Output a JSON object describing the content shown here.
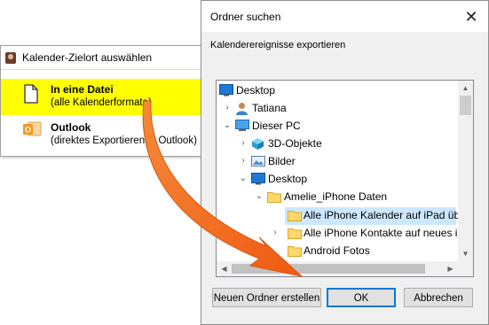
{
  "left_panel": {
    "title": "Kalender-Zielort auswählen",
    "options": [
      {
        "label": "In eine Datei",
        "sublabel": "(alle Kalenderformate)",
        "selected": true,
        "icon": "file-icon"
      },
      {
        "label": "Outlook",
        "sublabel": "(direktes Exportieren in Outlook)",
        "selected": false,
        "icon": "outlook-icon"
      }
    ]
  },
  "dialog": {
    "title": "Ordner suchen",
    "close_glyph": "✕",
    "description": "Kalenderereignisse exportieren",
    "tree": [
      {
        "label": "Desktop",
        "icon": "desktop-icon"
      },
      {
        "label": "Tatiana",
        "icon": "user-icon"
      },
      {
        "label": "Dieser PC",
        "icon": "pc-icon"
      },
      {
        "label": "3D-Objekte",
        "icon": "cube-icon"
      },
      {
        "label": "Bilder",
        "icon": "pictures-icon"
      },
      {
        "label": "Desktop",
        "icon": "desktop-icon"
      },
      {
        "label": "Amelie_iPhone Daten",
        "icon": "folder-icon"
      },
      {
        "label": "Alle iPhone Kalender auf iPad üb",
        "icon": "folder-icon",
        "selected": true
      },
      {
        "label": "Alle iPhone Kontakte auf neues il",
        "icon": "folder-icon"
      },
      {
        "label": "Android Fotos",
        "icon": "folder-icon"
      }
    ],
    "buttons": {
      "new_folder": "Neuen Ordner erstellen",
      "ok": "OK",
      "cancel": "Abbrechen"
    }
  },
  "colors": {
    "highlight_yellow": "#ffff00",
    "selection_blue": "#cce8ff",
    "arrow_orange": "#f26b1d",
    "folder_yellow": "#ffd86a"
  }
}
